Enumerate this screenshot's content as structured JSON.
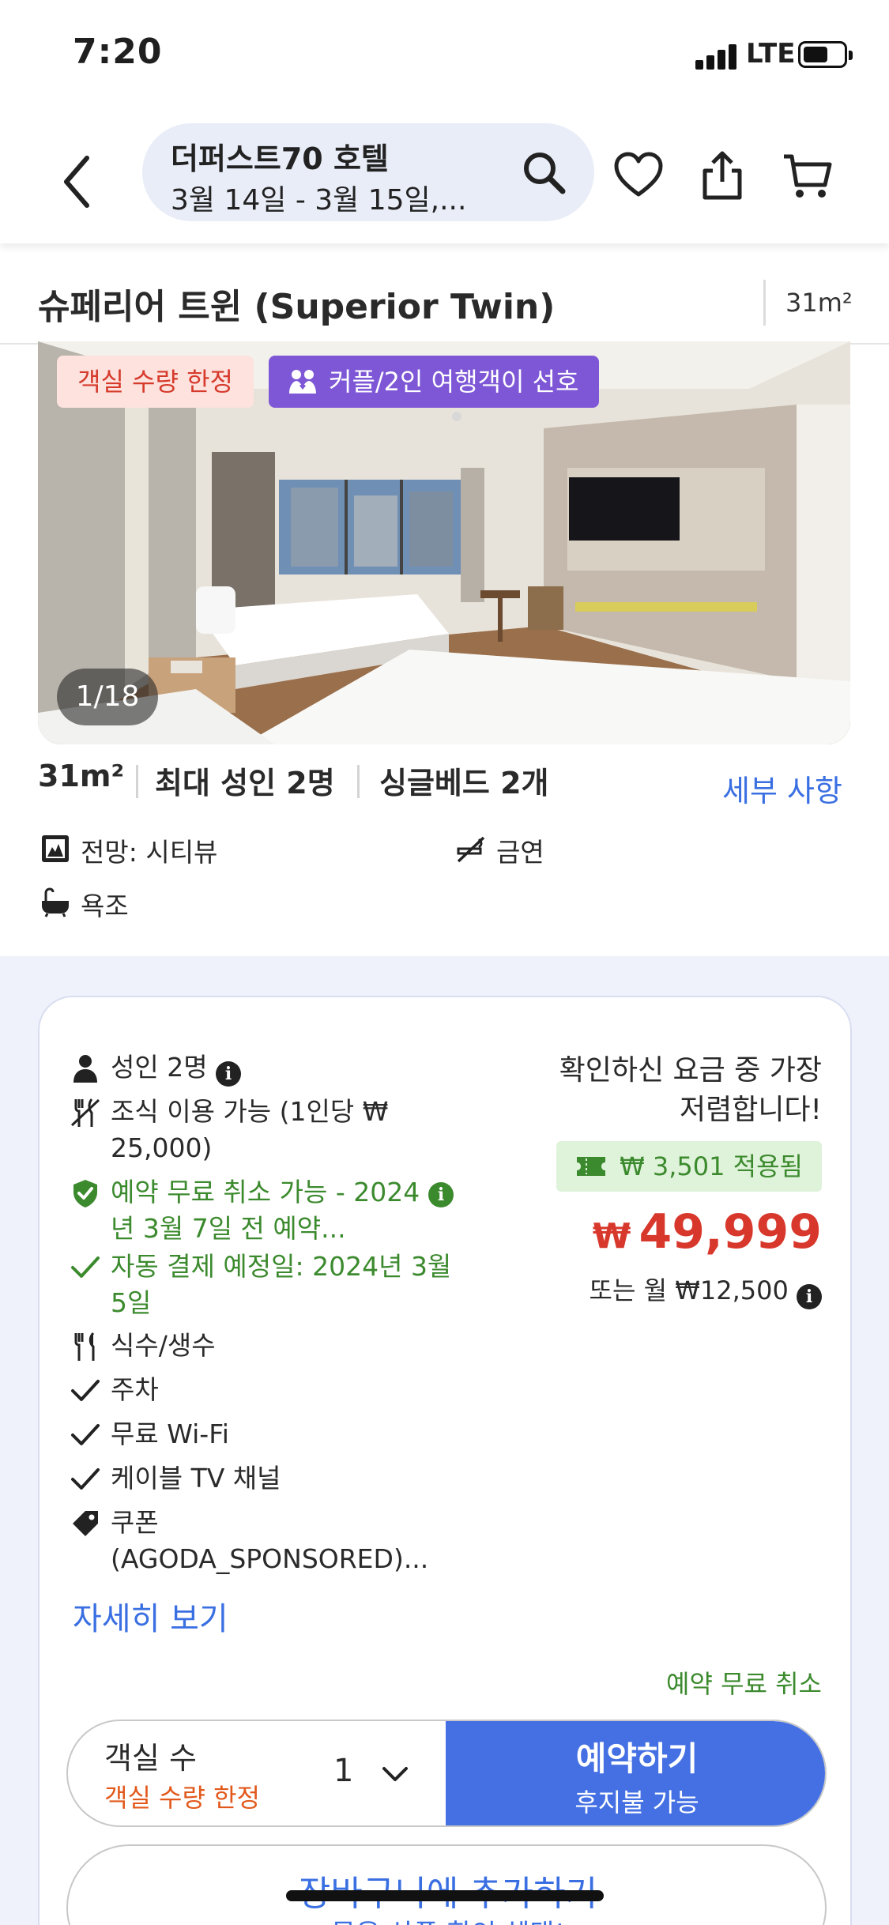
{
  "status_bar": {
    "time": "7:20",
    "network": "LTE"
  },
  "header": {
    "hotel_name": "더퍼스트70 호텔",
    "dates": "3월 14일 - 3월 15일,..."
  },
  "room": {
    "title": "슈페리어 트윈 (Superior Twin)",
    "size_label": "31m²",
    "badges": {
      "limited": "객실 수량 한정",
      "couple": "커플/2인 여행객이 선호"
    },
    "photo_counter": "1/18",
    "specs": [
      "31m²",
      "최대 성인 2명",
      "싱글베드 2개"
    ],
    "details_link": "세부 사항",
    "features": {
      "view": "전망: 시티뷰",
      "non_smoking": "금연",
      "bathtub": "욕조"
    }
  },
  "offer": {
    "inclusions": {
      "adults": "성인 2명",
      "breakfast": "조식 이용 가능 (1인당 ₩ 25,000)",
      "free_cancel": "예약 무료 취소 가능 - 2024년 3월 7일 전 예약...",
      "auto_pay": "자동 결제 예정일: 2024년 3월 5일",
      "water": "식수/생수",
      "parking": "주차",
      "wifi": "무료 Wi-Fi",
      "cable_tv": "케이블 TV 채널",
      "coupon": "쿠폰 (AGODA_SPONSORED)..."
    },
    "more_link": "자세히 보기",
    "cheapest_note": "확인하신 요금 중 가장 저렴합니다!",
    "coupon_applied": "₩ 3,501 적용됨",
    "price_currency": "₩",
    "price_amount": "49,999",
    "monthly": "또는 월 ₩12,500",
    "free_cancel_note": "예약 무료 취소",
    "rooms_label": "객실 수",
    "rooms_limited": "객실 수량 한정",
    "rooms_value": "1",
    "book_label": "예약하기",
    "book_sub": "후지불 가능",
    "cart_label": "장바구니에 추가하기",
    "cart_sub": "묶음 상품 할인 혜택!"
  },
  "colors": {
    "brand_blue": "#4470e4",
    "link_blue": "#3a6fe2",
    "price_red": "#d8382c",
    "green": "#3c8a2e",
    "couple_purple": "#7e57d6",
    "limited_orange": "#e2591c"
  },
  "icons": {
    "header": [
      "back-chevron-icon",
      "search-icon",
      "heart-icon",
      "share-icon",
      "cart-icon"
    ],
    "features": [
      "city-view-icon",
      "no-smoking-icon",
      "bathtub-icon"
    ],
    "inclusions": [
      "person-icon",
      "fork-knife-crossed-icon",
      "shield-check-icon",
      "check-icon",
      "fork-knife-icon",
      "tag-icon"
    ]
  }
}
